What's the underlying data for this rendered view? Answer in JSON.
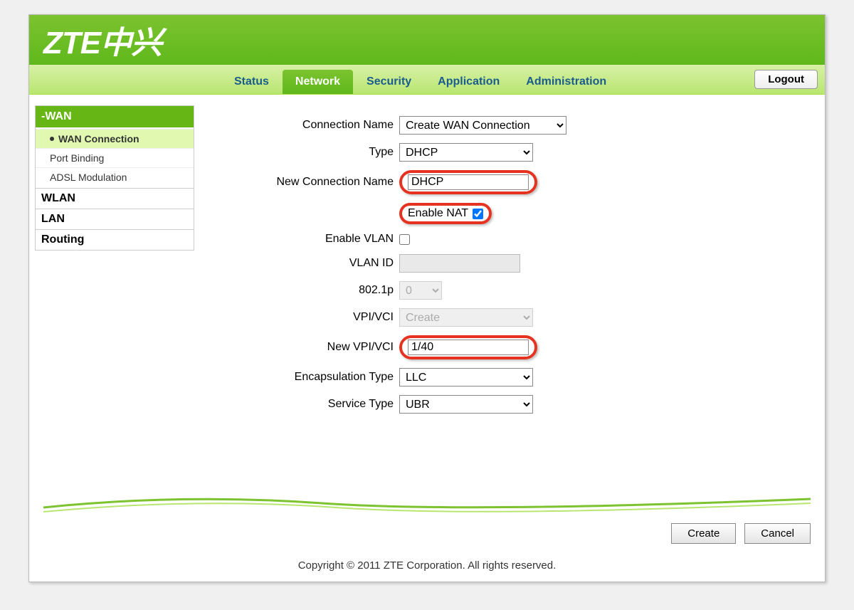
{
  "header": {
    "brand": "ZTE中兴"
  },
  "nav": {
    "tabs": [
      "Status",
      "Network",
      "Security",
      "Application",
      "Administration"
    ],
    "active_index": 1,
    "logout": "Logout"
  },
  "sidebar": {
    "active_group": "-WAN",
    "sub_items": [
      "WAN Connection",
      "Port Binding",
      "ADSL Modulation"
    ],
    "active_sub_index": 0,
    "groups": [
      "WLAN",
      "LAN",
      "Routing"
    ]
  },
  "form": {
    "labels": {
      "connection_name": "Connection Name",
      "type": "Type",
      "new_connection_name": "New Connection Name",
      "enable_nat": "Enable NAT",
      "enable_vlan": "Enable VLAN",
      "vlan_id": "VLAN ID",
      "p8021": "802.1p",
      "vpi_vci": "VPI/VCI",
      "new_vpi_vci": "New VPI/VCI",
      "encapsulation_type": "Encapsulation Type",
      "service_type": "Service Type"
    },
    "values": {
      "connection_name": "Create WAN Connection",
      "type": "DHCP",
      "new_connection_name": "DHCP",
      "enable_nat": true,
      "enable_vlan": false,
      "vlan_id": "",
      "p8021": "0",
      "vpi_vci": "Create",
      "new_vpi_vci": "1/40",
      "encapsulation_type": "LLC",
      "service_type": "UBR"
    }
  },
  "actions": {
    "create": "Create",
    "cancel": "Cancel"
  },
  "footer": {
    "copyright": "Copyright © 2011 ZTE Corporation. All rights reserved."
  }
}
